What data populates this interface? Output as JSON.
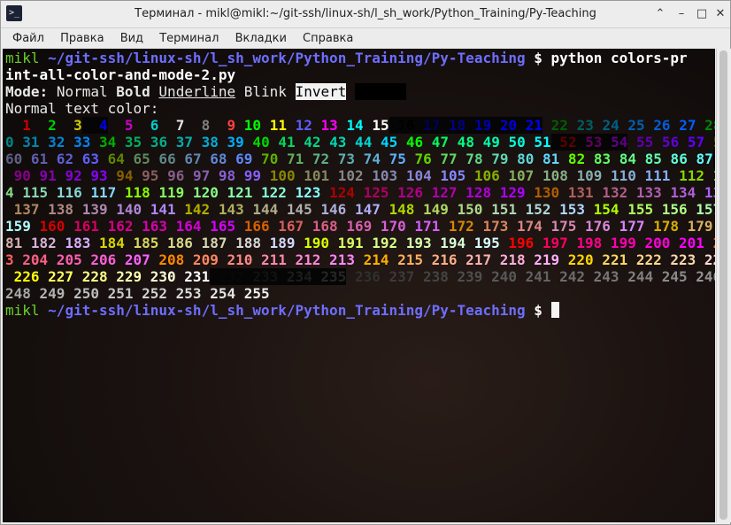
{
  "window": {
    "title": "Терминал - mikl@mikl:~/git-ssh/linux-sh/l_sh_work/Python_Training/Py-Teaching",
    "app_icon": "terminal-icon",
    "buttons": [
      "chevron-up-icon",
      "minimize-icon",
      "maximize-icon",
      "close-icon"
    ]
  },
  "menu": [
    "Файл",
    "Правка",
    "Вид",
    "Терминал",
    "Вкладки",
    "Справка"
  ],
  "terminal": {
    "user": "mikl",
    "path": "~/git-ssh/linux-sh/l_sh_work/Python_Training/Py-Teaching",
    "prompt_symbol": "$",
    "command_part1": "python colors-pr",
    "command_part2": "int-all-color-and-mode-2.py",
    "mode_label": "Mode:",
    "mode_normal": "Normal",
    "mode_bold": "Bold",
    "mode_underline": "Underline",
    "mode_blink": "Blink",
    "mode_invert": "Invert",
    "mode_hidden": "Hidden",
    "normal_text_label": "Normal text color:",
    "color_codes_start": 1,
    "color_codes_end": 255
  },
  "colors": {
    "user": "#6bd12a",
    "path": "#6e6eff",
    "background": "#120d0b"
  }
}
